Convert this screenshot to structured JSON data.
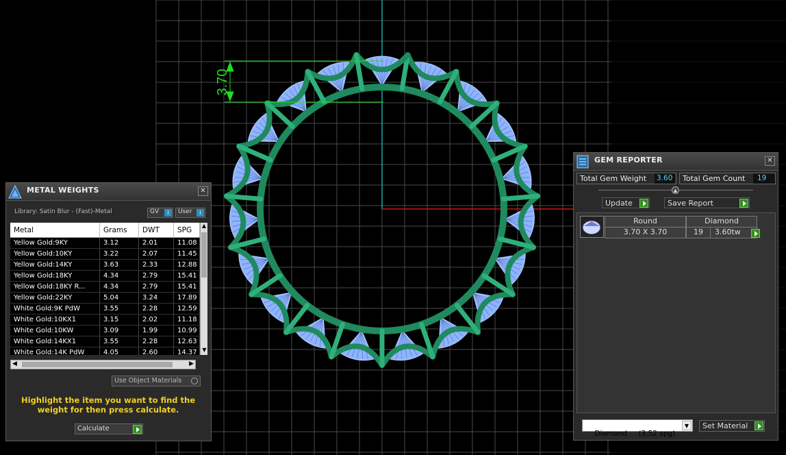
{
  "dimension_label": "3.70",
  "metal_weights": {
    "title": "METAL WEIGHTS",
    "library": "Library: Satin Blur - (Fast)-Metal",
    "gv_label": "GV",
    "user_label": "User",
    "columns": [
      "Metal",
      "Grams",
      "DWT",
      "SPG"
    ],
    "rows": [
      [
        "Yellow Gold:9KY",
        "3.12",
        "2.01",
        "11.08"
      ],
      [
        "Yellow Gold:10KY",
        "3.22",
        "2.07",
        "11.45"
      ],
      [
        "Yellow Gold:14KY",
        "3.63",
        "2.33",
        "12.88"
      ],
      [
        "Yellow Gold:18KY",
        "4.34",
        "2.79",
        "15.41"
      ],
      [
        "Yellow Gold:18KY R...",
        "4.34",
        "2.79",
        "15.41"
      ],
      [
        "Yellow Gold:22KY",
        "5.04",
        "3.24",
        "17.89"
      ],
      [
        "White Gold:9K PdW",
        "3.55",
        "2.28",
        "12.59"
      ],
      [
        "White Gold:10KX1",
        "3.15",
        "2.02",
        "11.18"
      ],
      [
        "White Gold:10KW",
        "3.09",
        "1.99",
        "10.99"
      ],
      [
        "White Gold:14KX1",
        "3.55",
        "2.28",
        "12.63"
      ],
      [
        "White Gold:14K PdW",
        "4.05",
        "2.60",
        "14.37"
      ]
    ],
    "use_object_materials": "Use Object Materials",
    "instruction": "Highlight the item you want to find the weight for then press calculate.",
    "calculate_label": "Calculate"
  },
  "gem_reporter": {
    "title": "GEM REPORTER",
    "total_weight_label": "Total Gem Weight",
    "total_weight_value": "3.60",
    "total_count_label": "Total Gem Count",
    "total_count_value": "19",
    "update_label": "Update",
    "save_report_label": "Save Report",
    "gem": {
      "cut": "Round",
      "material": "Diamond",
      "size": "3.70 X 3.70",
      "count": "19",
      "weight": "3.60tw"
    },
    "material_select": "Diamond     (3.52 spg)",
    "set_material_label": "Set Material"
  },
  "colors": {
    "grid": "#4a4a4a",
    "ring_metal": "#1f8a5e",
    "gem": "#8fb4ff",
    "dimension": "#22dd22",
    "axis_y": "#1aa6a6",
    "axis_x": "#d01818",
    "instruction_text": "#f0d020"
  }
}
